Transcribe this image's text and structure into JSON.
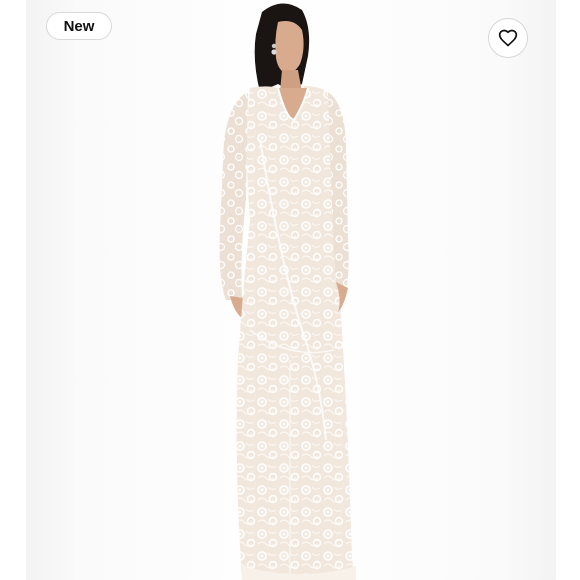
{
  "listing": {
    "badge_label": "New",
    "favorite_icon": "heart-outline-icon",
    "image_subject": "white-lace-gown-product-photo",
    "colors": {
      "background": "#ffffff",
      "badge_border": "#d8d8d8",
      "icon_stroke": "#111111",
      "dress_base": "#f4ece4",
      "lace": "#ffffff",
      "hair": "#1a1513",
      "skin": "#d9ab8e"
    }
  }
}
